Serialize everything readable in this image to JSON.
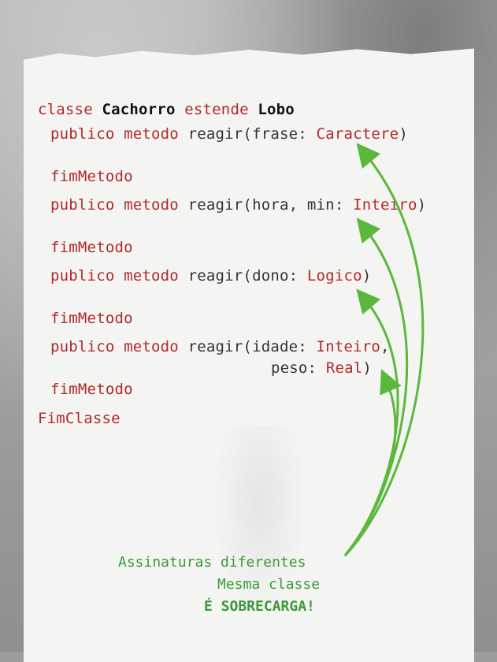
{
  "code": {
    "line1": {
      "kw1": "classe",
      "name": "Cachorro",
      "kw2": "estende",
      "parent": "Lobo"
    },
    "method1": {
      "kw": "publico metodo",
      "sig": "reagir(frase: ",
      "type": "Caractere",
      "close": ")"
    },
    "end1": "fimMetodo",
    "method2": {
      "kw": "publico metodo",
      "sig": "reagir(hora, min: ",
      "type": "Inteiro",
      "close": ")"
    },
    "end2": "fimMetodo",
    "method3": {
      "kw": "publico metodo",
      "sig": "reagir(dono: ",
      "type": "Logico",
      "close": ")"
    },
    "end3": "fimMetodo",
    "method4": {
      "kw": "publico metodo",
      "sig": "reagir(idade: ",
      "type": "Inteiro",
      "comma": ",",
      "sig2": "peso: ",
      "type2": "Real",
      "close": ")"
    },
    "end4": "fimMetodo",
    "endclass": "FimClasse"
  },
  "notes": {
    "line1": "Assinaturas diferentes",
    "line2": "Mesma classe",
    "line3": "É SOBRECARGA!"
  },
  "colors": {
    "keyword": "#b02a2a",
    "arrow": "#5cb83c",
    "note": "#3a9a38"
  }
}
